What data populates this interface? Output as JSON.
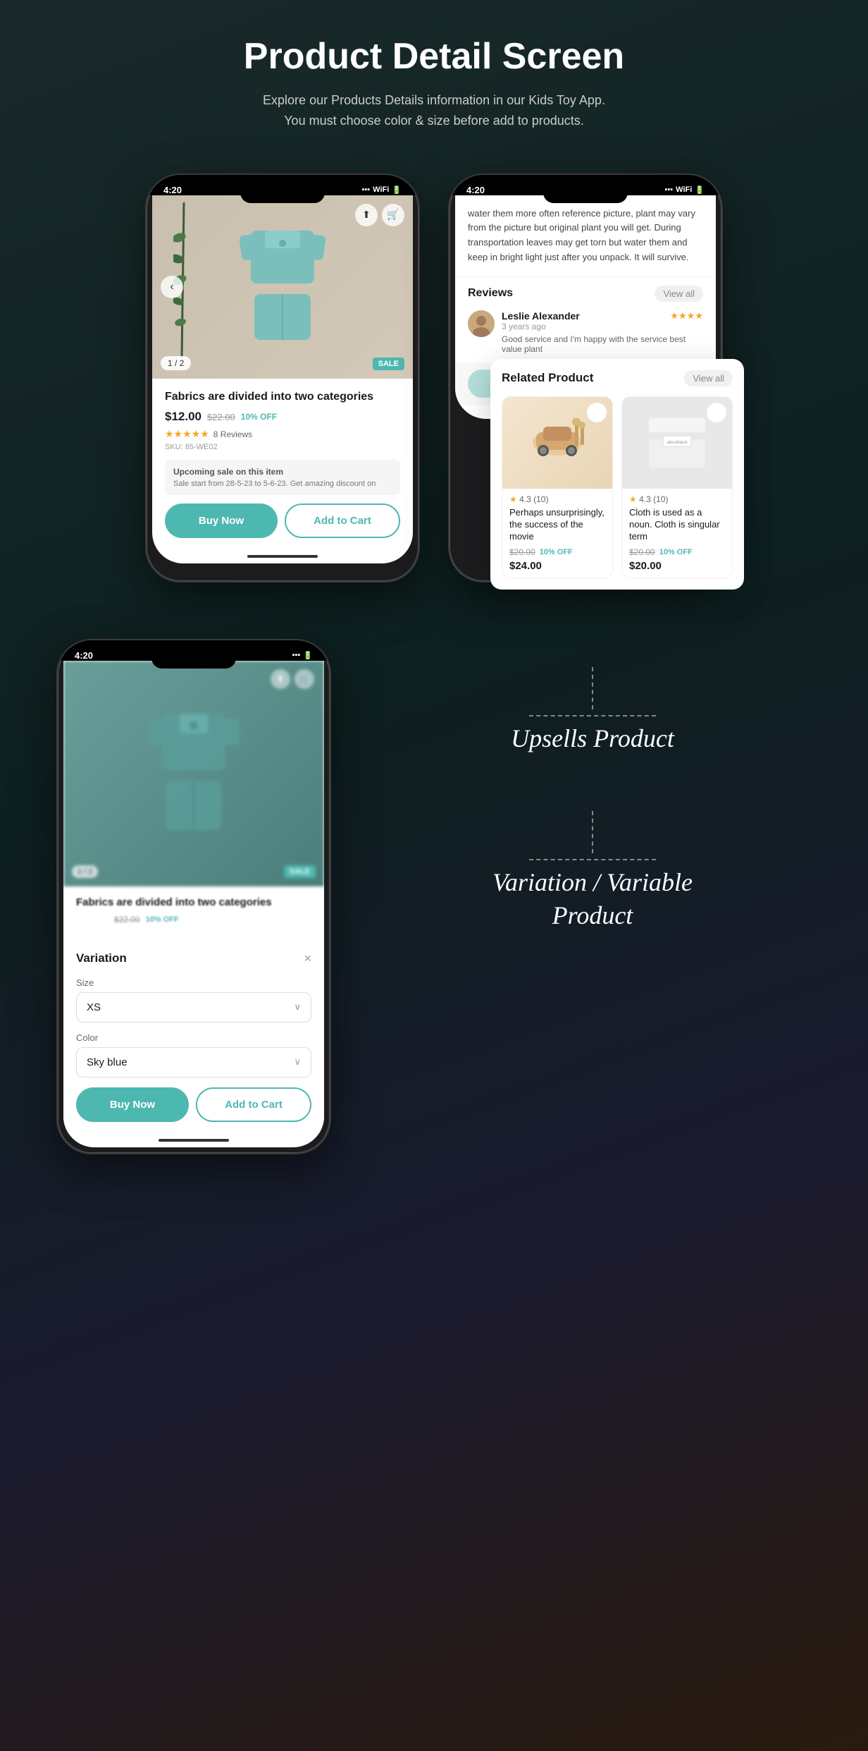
{
  "header": {
    "title": "Product Detail Screen",
    "subtitle_line1": "Explore our Products Details information in our Kids Toy App.",
    "subtitle_line2": "You must choose color & size before add to products."
  },
  "phone_left": {
    "status_time": "4:20",
    "image_counter": "1 / 2",
    "sale_badge": "SALE",
    "product": {
      "title": "Fabrics are divided into two categories",
      "price": "$12.00",
      "original_price": "$22.00",
      "discount": "10% OFF",
      "stars": "★★★★★",
      "reviews": "8 Reviews",
      "sku": "SKU: 85-WE02",
      "sale_section_title": "Upcoming sale on this item",
      "sale_text": "Sale start from 28-5-23 to 5-6-23. Get amazing discount on",
      "btn_buy": "Buy Now",
      "btn_cart": "Add to Cart"
    }
  },
  "phone_right": {
    "status_time": "4:20",
    "review_text": "water them more often reference picture, plant may vary from the picture but original plant you will get. During transportation leaves may get torn but water them and keep in bright light just after you unpack. It will survive.",
    "reviews_section": {
      "title": "Reviews",
      "view_all": "View all",
      "reviewer_name": "Leslie Alexander",
      "reviewer_date": "3 years ago",
      "reviewer_stars": "★★★★",
      "review_preview": "Good service and I'm happy with the service best value plant"
    }
  },
  "related_product_popup": {
    "title": "Related Product",
    "view_all": "View all",
    "products": [
      {
        "rating": "4.3 (10)",
        "title": "Perhaps unsurprisingly, the success of the movie",
        "original_price": "$20.00",
        "discount": "10% OFF",
        "price": "$24.00",
        "type": "toy"
      },
      {
        "rating": "4.3 (10)",
        "title": "Cloth is used as a noun. Cloth is singular term",
        "original_price": "$20.00",
        "discount": "10% OFF",
        "price": "$20.00",
        "type": "clothes"
      }
    ]
  },
  "annotation_upsells": "Upsells Product",
  "annotation_variation": "Variation / Variable\nProduct",
  "phone_bottom": {
    "status_time": "4:20",
    "variation_drawer": {
      "title": "Variation",
      "size_label": "Size",
      "size_value": "XS",
      "color_label": "Color",
      "color_value": "Sky blue",
      "btn_buy": "Buy Now",
      "btn_cart": "Add to Cart"
    }
  },
  "icons": {
    "back": "‹",
    "share": "↑",
    "cart": "🛒",
    "heart_empty": "♡",
    "heart_filled": "♡",
    "close": "×",
    "chevron_down": "∨",
    "star_filled": "★",
    "star_empty": "☆"
  }
}
